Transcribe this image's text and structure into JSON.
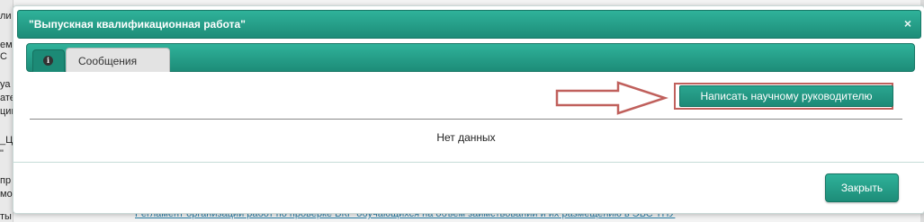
{
  "background": {
    "sidebar_fragments": [
      "ли",
      "еме",
      "С",
      "уа",
      "ате",
      "ции",
      "_Ци",
      "\"",
      "пр",
      "мо",
      "ты"
    ],
    "link_text": "Регламент организации работ по проверке ВКР обучающихся на объем заимствований и их размещению в ЭБС ТПУ"
  },
  "modal": {
    "title": "\"Выпускная квалификационная работа\"",
    "close_glyph": "×",
    "tabs": {
      "info_glyph": "i",
      "messages_label": "Сообщения"
    },
    "write_button_label": "Написать научному руководителю",
    "empty_text": "Нет данных",
    "footer_close_label": "Закрыть"
  },
  "colors": {
    "header_teal": "#1d8c78",
    "highlight_red": "#c0605c"
  }
}
